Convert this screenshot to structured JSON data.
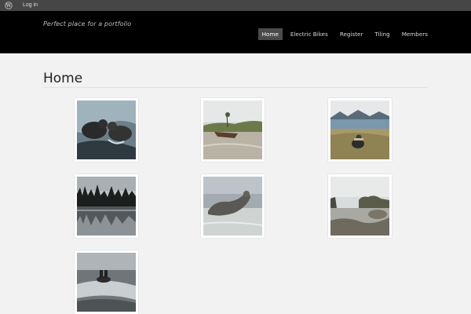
{
  "adminbar": {
    "logo_icon": "wordpress-icon",
    "login_label": "Log in"
  },
  "header": {
    "tagline": "Perfect place for a portfolio",
    "nav": [
      {
        "label": "Home",
        "active": true
      },
      {
        "label": "Electric Bikes",
        "active": false
      },
      {
        "label": "Register",
        "active": false
      },
      {
        "label": "Tiling",
        "active": false
      },
      {
        "label": "Members",
        "active": false
      }
    ]
  },
  "page": {
    "title": "Home"
  },
  "gallery": [
    {
      "subject": "seals-on-rocks"
    },
    {
      "subject": "boat-on-beach"
    },
    {
      "subject": "person-on-grass-by-lake"
    },
    {
      "subject": "tree-line-reflection"
    },
    {
      "subject": "seal-on-sand"
    },
    {
      "subject": "rocky-coast"
    },
    {
      "subject": "people-on-rock-in-surf"
    }
  ],
  "colors": {
    "adminbar": "#464646",
    "header": "#000000",
    "nav_active": "#4a4a4a",
    "background": "#f2f2f2"
  }
}
